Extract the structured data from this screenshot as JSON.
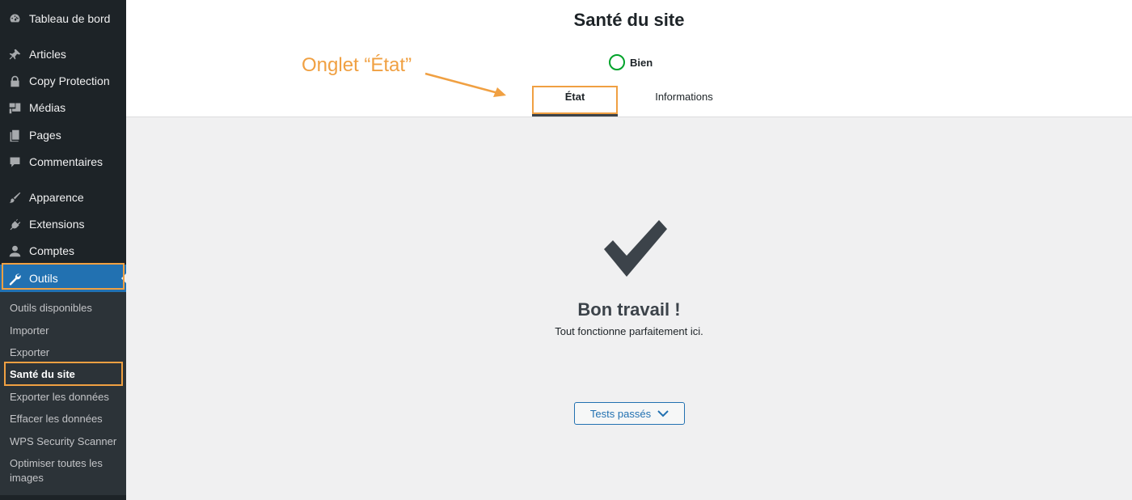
{
  "sidebar": {
    "items": [
      {
        "label": "Tableau de bord",
        "icon": "dashboard-icon"
      },
      {
        "label": "Articles",
        "icon": "pin-icon"
      },
      {
        "label": "Copy Protection",
        "icon": "lock-icon"
      },
      {
        "label": "Médias",
        "icon": "media-icon"
      },
      {
        "label": "Pages",
        "icon": "pages-icon"
      },
      {
        "label": "Commentaires",
        "icon": "comment-icon"
      },
      {
        "label": "Apparence",
        "icon": "brush-icon"
      },
      {
        "label": "Extensions",
        "icon": "plugin-icon"
      },
      {
        "label": "Comptes",
        "icon": "user-icon"
      },
      {
        "label": "Outils",
        "icon": "wrench-icon",
        "active": true
      }
    ],
    "submenu": [
      "Outils disponibles",
      "Importer",
      "Exporter",
      "Santé du site",
      "Exporter les données",
      "Effacer les données",
      "WPS Security Scanner",
      "Optimiser toutes les images"
    ],
    "current_submenu": "Santé du site"
  },
  "header": {
    "title": "Santé du site",
    "status_label": "Bien",
    "status_color": "#00a32a",
    "tabs": [
      {
        "label": "État",
        "active": true
      },
      {
        "label": "Informations",
        "active": false
      }
    ]
  },
  "annotation": {
    "text": "Onglet “État”",
    "color": "#f0a042"
  },
  "main": {
    "title": "Bon travail !",
    "description": "Tout fonctionne parfaitement ici.",
    "button_label": "Tests passés"
  },
  "colors": {
    "sidebar_bg": "#1d2327",
    "accent": "#2271b1",
    "highlight": "#f0a042"
  }
}
